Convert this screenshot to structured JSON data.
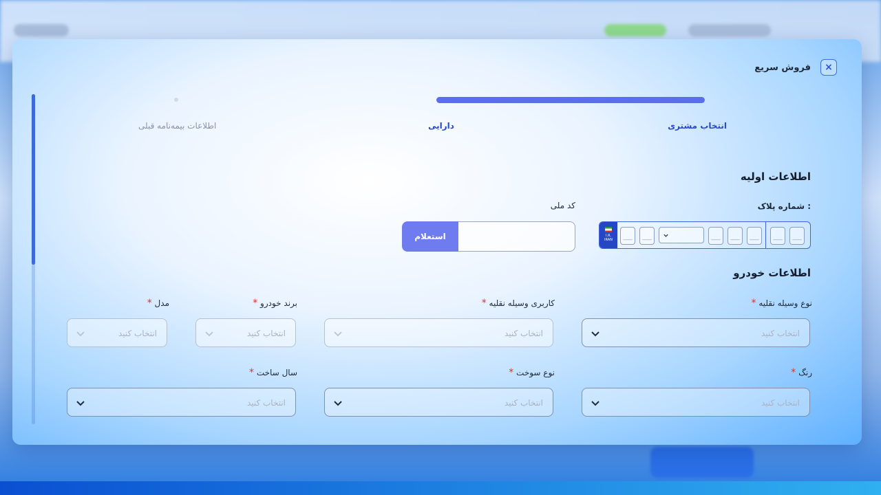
{
  "modal": {
    "title": "فروش سریع",
    "close_label": "×"
  },
  "steps": [
    {
      "label": "انتخاب مشتری"
    },
    {
      "label": "دارایی"
    },
    {
      "label": "اطلاعات بیمه‌نامه قبلی"
    }
  ],
  "progress": {
    "completed_fraction": 0.5
  },
  "basic": {
    "title": "اطلاعات اولیه",
    "plate_label": "شماره پلاک :",
    "plate_country": "I.R.\nIRAN",
    "national_code_label": "کد ملی",
    "inquiry_button": "استعلام"
  },
  "vehicle": {
    "title": "اطلاعات خودرو",
    "placeholder": "انتخاب کنید",
    "fields": {
      "vehicle_type": "نوع وسیله نقلیه",
      "vehicle_usage": "کاربری وسیله نقلیه",
      "brand": "برند خودرو",
      "model": "مدل",
      "color": "رنگ",
      "fuel_type": "نوع سوخت",
      "year": "سال ساخت"
    }
  },
  "colors": {
    "accent": "#5b6ef0",
    "button": "#6f7cf0",
    "required": "#e0302f",
    "title": "#141d2b"
  }
}
